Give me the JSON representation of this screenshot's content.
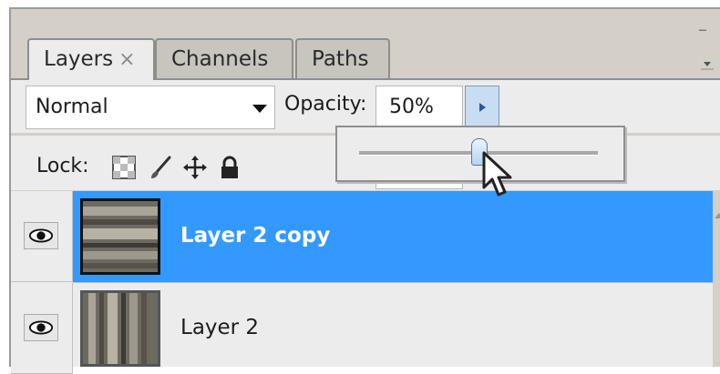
{
  "tabs": [
    {
      "label": "Layers",
      "close": "×",
      "active": true
    },
    {
      "label": "Channels",
      "active": false
    },
    {
      "label": "Paths",
      "active": false
    }
  ],
  "options": {
    "blend_mode": "Normal",
    "opacity_label": "Opacity:",
    "opacity_value": "50%",
    "opacity_slider_fraction": 0.5
  },
  "lock": {
    "label": "Lock:",
    "icons": [
      "lock-transparent-icon",
      "lock-paint-brush-icon",
      "lock-move-icon",
      "lock-all-padlock-icon"
    ]
  },
  "layers": [
    {
      "name": "Layer 2 copy",
      "selected": true
    },
    {
      "name": "Layer 2",
      "selected": false
    }
  ],
  "colors": {
    "selection": "#3399ff",
    "panel": "#ececec",
    "slider_button": "#c9ddf2"
  }
}
